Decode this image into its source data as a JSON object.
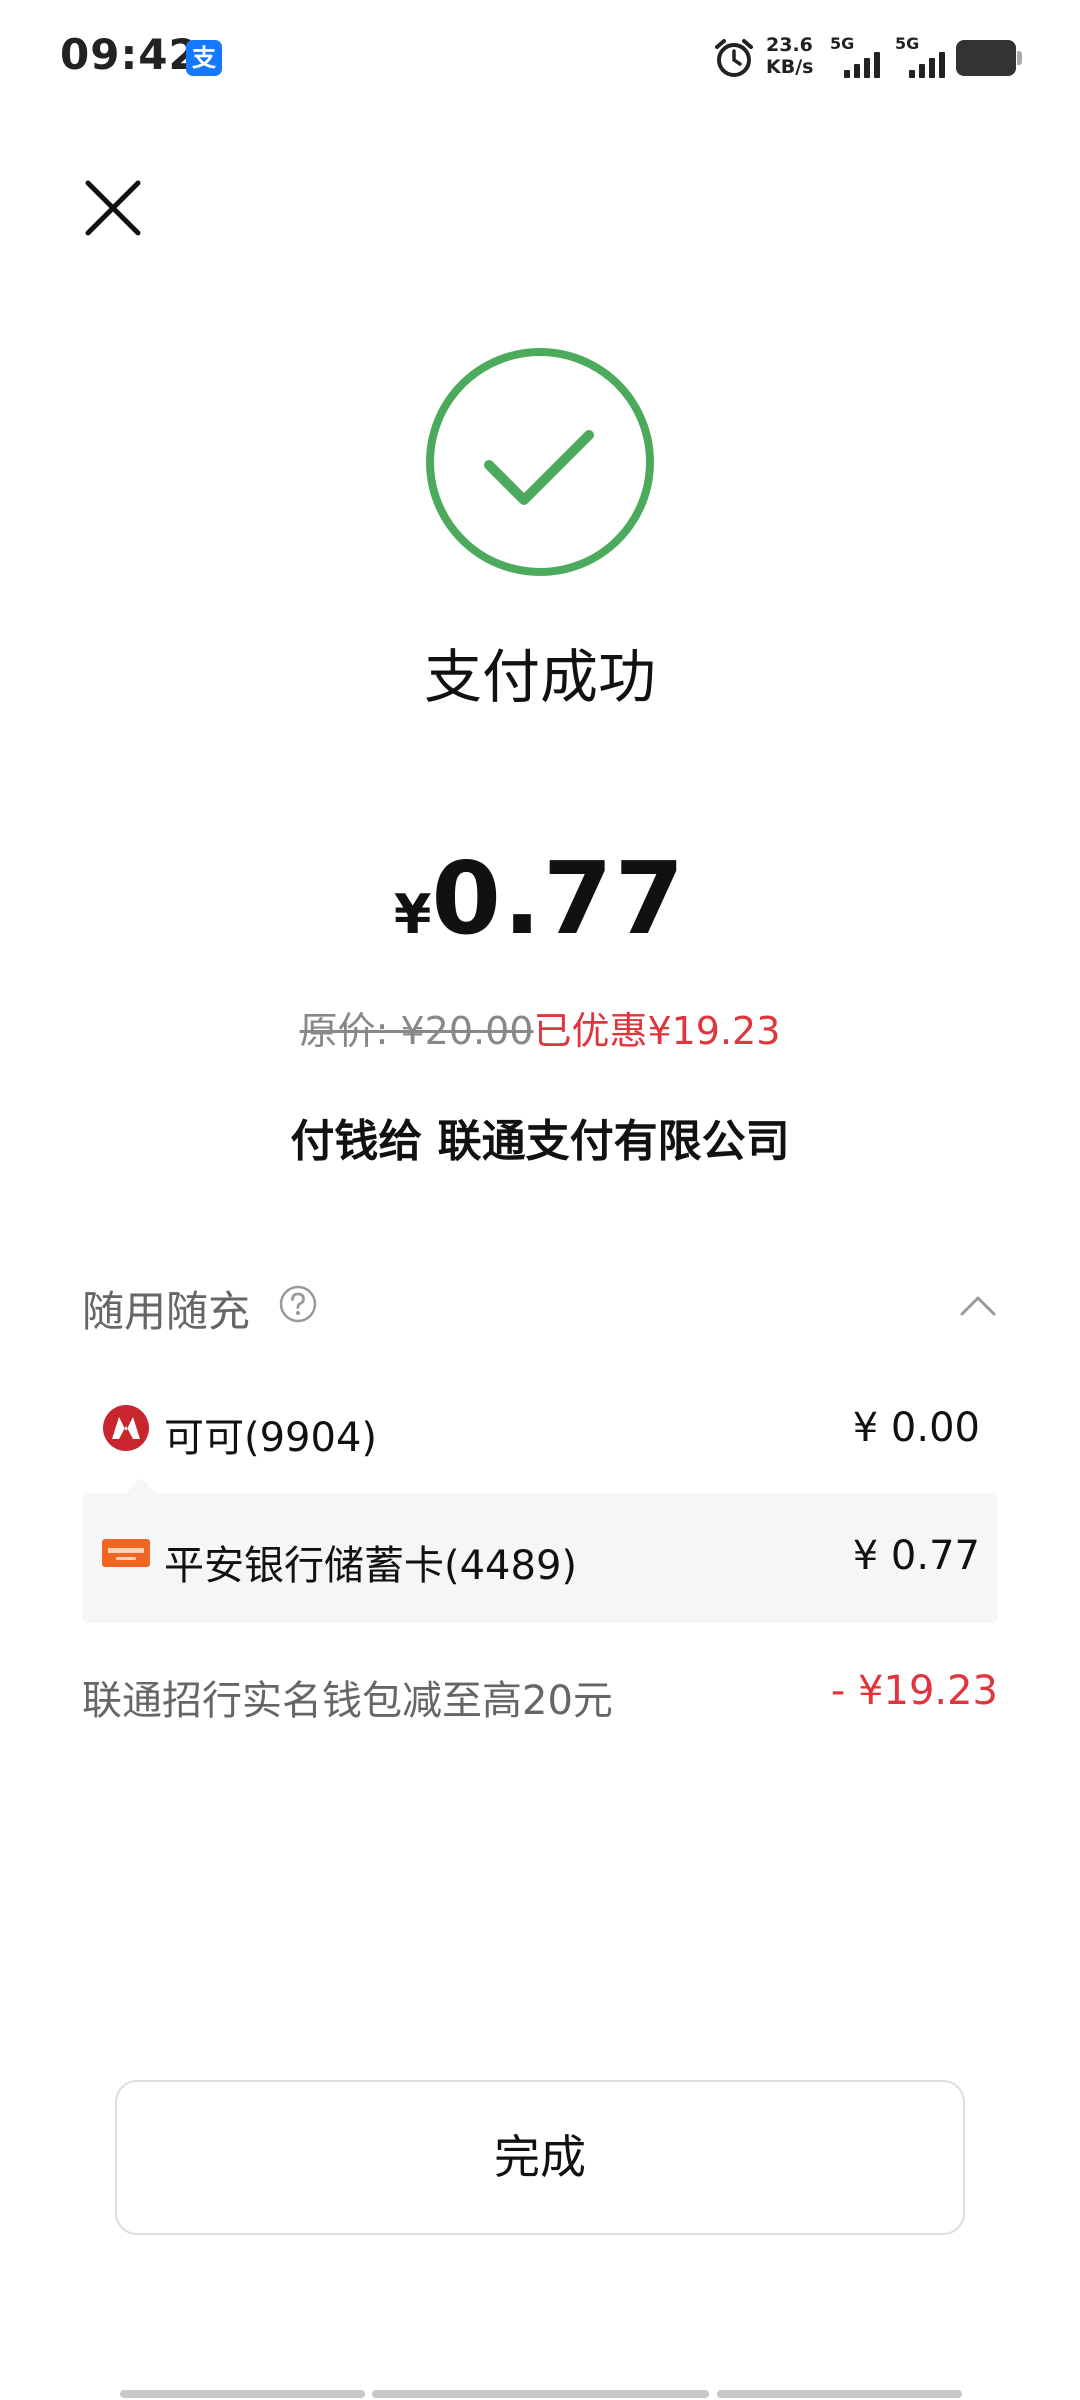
{
  "status_bar": {
    "time": "09:42",
    "app_badge": "支",
    "net_speed_value": "23.6",
    "net_speed_unit": "KB/s",
    "sim1_label": "5G",
    "sim2_label": "5G",
    "colors": {
      "alipay_blue": "#1677ff"
    }
  },
  "header": {
    "close_icon": "close-icon"
  },
  "result": {
    "title": "支付成功",
    "currency_symbol": "¥",
    "amount": "0.77",
    "original_price": "原价: ¥20.00",
    "discount_text": "已优惠¥19.23",
    "payee": "付钱给 联通支付有限公司",
    "colors": {
      "success_green": "#4caa5c",
      "discount_red": "#e0353c"
    }
  },
  "breakdown": {
    "title": "随用随充",
    "help_icon": "question-circle-icon",
    "collapse_icon": "chevron-up-icon",
    "payments": [
      {
        "icon": "cmb-logo-icon",
        "label": "可可(9904)",
        "amount": "¥ 0.00"
      },
      {
        "icon": "pingan-card-icon",
        "label": "平安银行储蓄卡(4489)",
        "amount": "¥ 0.77"
      }
    ],
    "discount": {
      "label": "联通招行实名钱包减至高20元",
      "amount": "- ¥19.23"
    }
  },
  "actions": {
    "done_label": "完成"
  }
}
